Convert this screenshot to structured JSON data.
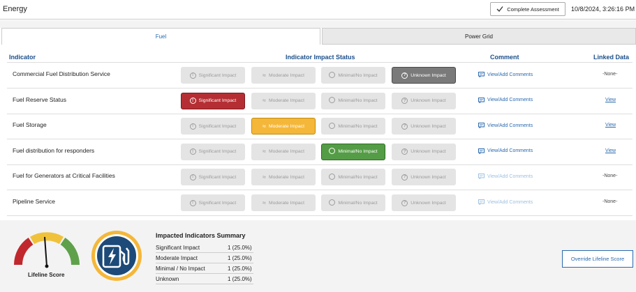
{
  "header": {
    "title": "Energy",
    "complete_label": "Complete Assessment",
    "datetime": "10/8/2024, 3:26:16 PM"
  },
  "tabs": [
    {
      "label": "Fuel",
      "active": true
    },
    {
      "label": "Power Grid",
      "active": false
    }
  ],
  "columns": {
    "indicator": "Indicator",
    "status": "Indicator Impact Status",
    "comment": "Comment",
    "linked": "Linked Data"
  },
  "status_labels": {
    "significant": "Significant Impact",
    "moderate": "Moderate Impact",
    "minimal": "Minimal/No Impact",
    "unknown": "Unknown Impact"
  },
  "rows": [
    {
      "label": "Commercial Fuel Distribution Service",
      "selected": "unknown",
      "comment": "View/Add Comments",
      "comment_enabled": true,
      "linked": "-None-"
    },
    {
      "label": "Fuel Reserve Status",
      "selected": "significant",
      "comment": "View/Add Comments",
      "comment_enabled": true,
      "linked": "View"
    },
    {
      "label": "Fuel Storage",
      "selected": "moderate",
      "comment": "View/Add Comments",
      "comment_enabled": true,
      "linked": "View"
    },
    {
      "label": "Fuel distribution for responders",
      "selected": "minimal",
      "comment": "View/Add Comments",
      "comment_enabled": true,
      "linked": "View"
    },
    {
      "label": "Fuel for Generators at Critical Facilities",
      "selected": "none",
      "comment": "View/Add Comments",
      "comment_enabled": false,
      "linked": "-None-"
    },
    {
      "label": "Pipeline Service",
      "selected": "none",
      "comment": "View/Add Comments",
      "comment_enabled": false,
      "linked": "-None-"
    }
  ],
  "gauge": {
    "label": "Lifeline Score",
    "colors": [
      "#c0282d",
      "#f0c23b",
      "#5fa14a"
    ]
  },
  "badge": {
    "icon": "fuel-pump-lightning-icon",
    "ring_color": "#f4b73a",
    "fill_color": "#1d4a78"
  },
  "summary": {
    "title": "Impacted Indicators Summary",
    "items": [
      {
        "label": "Significant Impact",
        "value": "1 (25.0%)"
      },
      {
        "label": "Moderate Impact",
        "value": "1 (25.0%)"
      },
      {
        "label": "Minimal / No Impact",
        "value": "1 (25.0%)"
      },
      {
        "label": "Unknown",
        "value": "1 (25.0%)"
      }
    ]
  },
  "override_label": "Override Lifeline Score"
}
